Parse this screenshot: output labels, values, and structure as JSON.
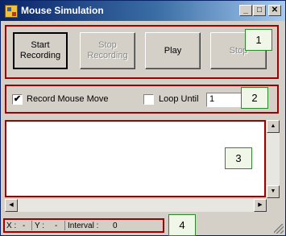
{
  "window": {
    "title": "Mouse Simulation",
    "minimize_glyph": "_",
    "maximize_glyph": "□",
    "close_glyph": "✕"
  },
  "recording_controls": {
    "start_recording_line1": "Start",
    "start_recording_line2": "Recording",
    "stop_recording_line1": "Stop",
    "stop_recording_line2": "Recording",
    "play_label": "Play",
    "stop_label": "Stop",
    "callout": "1"
  },
  "options": {
    "record_mouse_move_checked": "✔",
    "record_mouse_move_label": "Record Mouse Move",
    "loop_until_checked": "",
    "loop_until_label": "Loop Until",
    "loop_count_value": "1",
    "callout": "2"
  },
  "event_list": {
    "callout": "3",
    "scroll_up_glyph": "▲",
    "scroll_down_glyph": "▼",
    "scroll_left_glyph": "◀",
    "scroll_right_glyph": "▶"
  },
  "status": {
    "x_label": "X :",
    "x_value": "-",
    "y_label": "Y :",
    "y_value": "-",
    "interval_label": "Interval :",
    "interval_value": "0",
    "callout": "4"
  }
}
